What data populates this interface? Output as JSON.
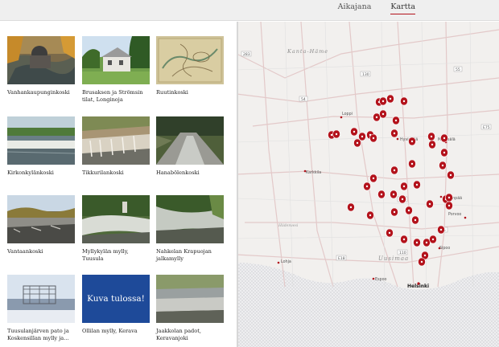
{
  "nav": {
    "timeline": "Aikajana",
    "map": "Kartta"
  },
  "tiles": [
    {
      "caption": "Vanhankaupunginkoski"
    },
    {
      "caption": "Brusaksen ja Strömsin tilat, Longinoja"
    },
    {
      "caption": "Ruutinkoski"
    },
    {
      "caption": "Kirkonkylänkoski"
    },
    {
      "caption": "Tikkurilankoski"
    },
    {
      "caption": "Hanabölenkoski"
    },
    {
      "caption": "Vantaankoski"
    },
    {
      "caption": "Myllykylän mylly, Tuusula"
    },
    {
      "caption": "Nahkelan Krapuojan jalkamylly"
    },
    {
      "caption": "Tuusulanjärven pato ja Koskensillan mylly ja..."
    },
    {
      "caption": "Ollilan mylly, Kerava",
      "placeholder": "Kuva tulossa!"
    },
    {
      "caption": "Jaakkolan padot, Keravanjoki"
    }
  ],
  "map": {
    "region_labels": [
      "Kanta-Häme",
      "Uusimaa",
      "Hiidenvesi"
    ],
    "city_labels": [
      "Loppi",
      "Karkkila",
      "Hyvinkää",
      "Lohja",
      "Espoo",
      "Helsinki",
      "Porvoo",
      "Mäntsälä",
      "Sipoo",
      "Järvenpää"
    ],
    "road_numbers": [
      "283",
      "130",
      "54",
      "E12",
      "E75",
      "E18",
      "25",
      "110",
      "55"
    ],
    "marker_color": "#b3121b"
  }
}
